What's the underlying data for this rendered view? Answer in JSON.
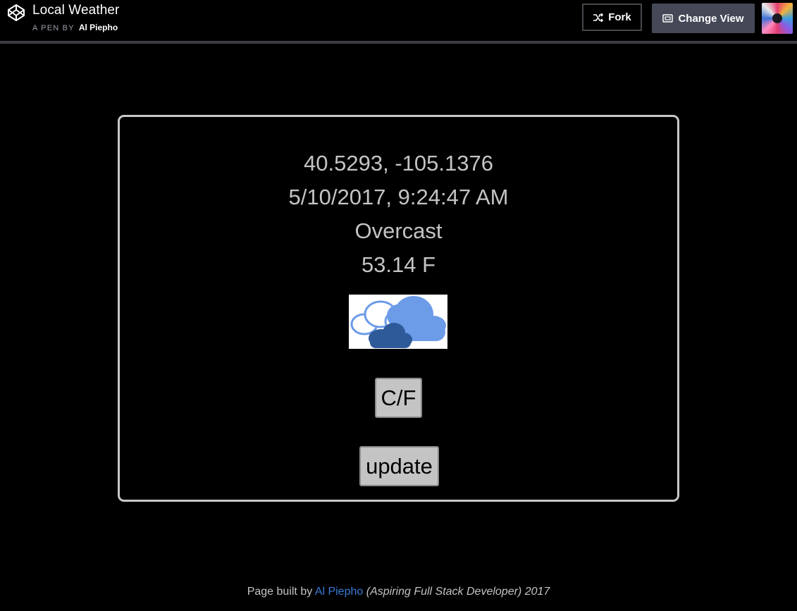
{
  "header": {
    "title": "Local Weather",
    "pen_by": "A PEN BY",
    "author": "Al Piepho",
    "fork_label": "Fork",
    "change_view_label": "Change View"
  },
  "weather": {
    "coordinates": "40.5293, -105.1376",
    "datetime": "5/10/2017, 9:24:47 AM",
    "condition": "Overcast",
    "temperature": "53.14 F",
    "icon": "overcast-cloud-icon"
  },
  "buttons": {
    "toggle_units": "C/F",
    "update": "update"
  },
  "footer": {
    "prefix": "Page built by",
    "author_link": "Al Piepho",
    "tagline": "(Aspiring Full Stack Developer) 2017"
  },
  "colors": {
    "background": "#000000",
    "text": "#c4c4c4",
    "link": "#3a7bd5",
    "card_border": "#c8c8c8",
    "button_bg": "#c4c4c4"
  }
}
